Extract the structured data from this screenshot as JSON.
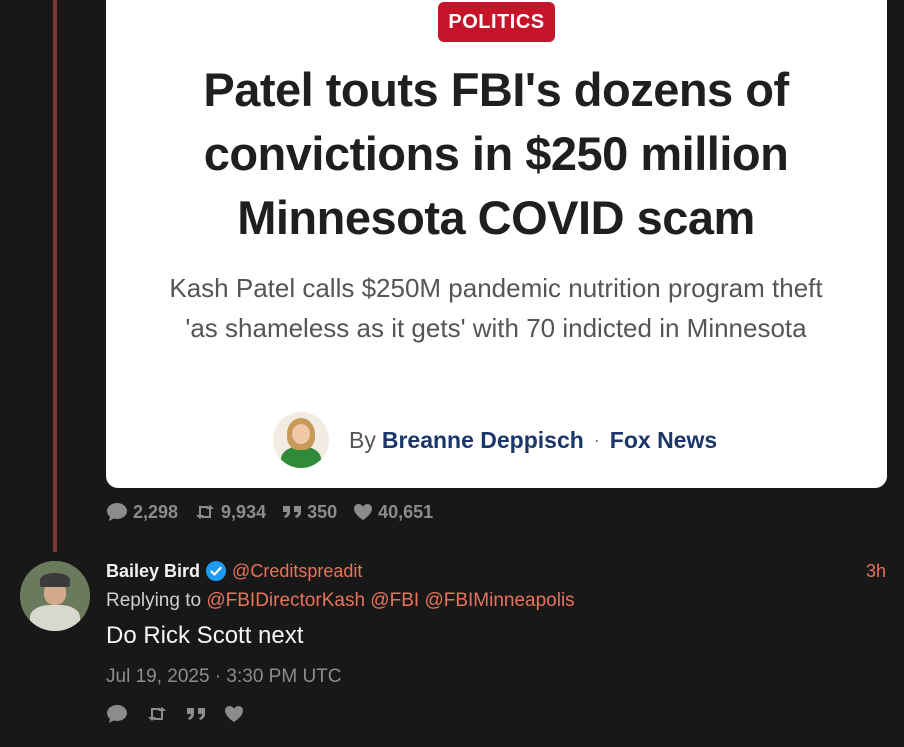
{
  "article": {
    "category": "POLITICS",
    "headline": "Patel touts FBI's dozens of convictions in $250 million Minnesota COVID scam",
    "subheadline": "Kash Patel calls $250M pandemic nutrition program theft 'as shameless as it gets' with 70 indicted in Minnesota",
    "by_word": "By",
    "author": "Breanne Deppisch",
    "separator": "·",
    "outlet": "Fox News"
  },
  "stats": {
    "replies": "2,298",
    "reposts": "9,934",
    "quotes": "350",
    "likes": "40,651"
  },
  "reply": {
    "display_name": "Bailey Bird",
    "handle": "@Creditspreadit",
    "time_ago": "3h",
    "replying_prefix": "Replying to",
    "mentions": [
      "@FBIDirectorKash",
      "@FBI",
      "@FBIMinneapolis"
    ],
    "text": "Do Rick Scott next",
    "timestamp": "Jul 19, 2025 · 3:30 PM UTC"
  },
  "colors": {
    "background": "#181818",
    "accent": "#e8735a",
    "badge": "#c6142b",
    "verified": "#1d9bf0",
    "muted": "#8c8c8c"
  }
}
